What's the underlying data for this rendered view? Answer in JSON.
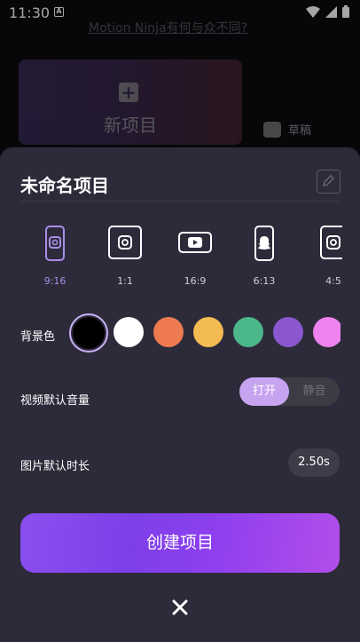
{
  "status_bar": {
    "time": "11:30",
    "notification_icon": "A"
  },
  "background": {
    "link_text": "Motion Ninja有何与众不同?",
    "new_project_label": "新项目",
    "draft_label": "草稿"
  },
  "sheet": {
    "title": "未命名项目",
    "ratios": [
      {
        "label": "9:16",
        "icon": "phone-portrait-icon",
        "selected": true
      },
      {
        "label": "1:1",
        "icon": "instagram-icon",
        "selected": false
      },
      {
        "label": "16:9",
        "icon": "youtube-icon",
        "selected": false
      },
      {
        "label": "6:13",
        "icon": "snapchat-icon",
        "selected": false
      },
      {
        "label": "4:5",
        "icon": "instagram-icon",
        "selected": false
      }
    ],
    "background_color_label": "背景色",
    "background_colors": [
      "#000000",
      "#ffffff",
      "#ee7a4f",
      "#f3bb52",
      "#4bb78a",
      "#8b57cf",
      "#ee82ee"
    ],
    "volume_label": "视频默认音量",
    "volume_on": "打开",
    "volume_mute": "静音",
    "image_duration_label": "图片默认时长",
    "image_duration_value": "2.50s",
    "create_button": "创建项目"
  },
  "colors": {
    "accent": "#a98de8",
    "sheet_bg": "#2d2b3a"
  }
}
